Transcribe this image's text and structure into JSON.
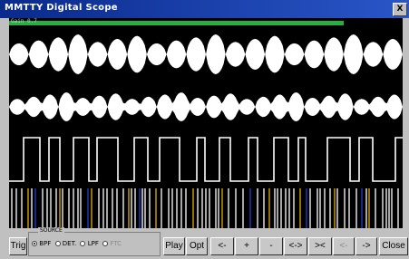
{
  "window": {
    "title": "MMTTY Digital Scope",
    "close_label": "X"
  },
  "gain": {
    "label": "Gain 0.7"
  },
  "bottom": {
    "trig_label": "Trig",
    "source": {
      "legend": "SOURCE",
      "options": [
        {
          "label": "BPF",
          "selected": true,
          "enabled": true
        },
        {
          "label": "DET.",
          "selected": false,
          "enabled": true
        },
        {
          "label": "LPF",
          "selected": false,
          "enabled": true
        },
        {
          "label": "FTC",
          "selected": false,
          "enabled": false
        }
      ]
    },
    "play_label": "Play",
    "opt_label": "Opt",
    "nav": [
      "<-",
      "+",
      "-",
      "<->",
      "><",
      "<-",
      "->"
    ],
    "close_label": "Close"
  },
  "colors": {
    "trace": "#ffffff",
    "background": "#000000",
    "gain": "#26b040",
    "marker_yellow": "#e0b000",
    "marker_blue": "#2040d0"
  }
}
